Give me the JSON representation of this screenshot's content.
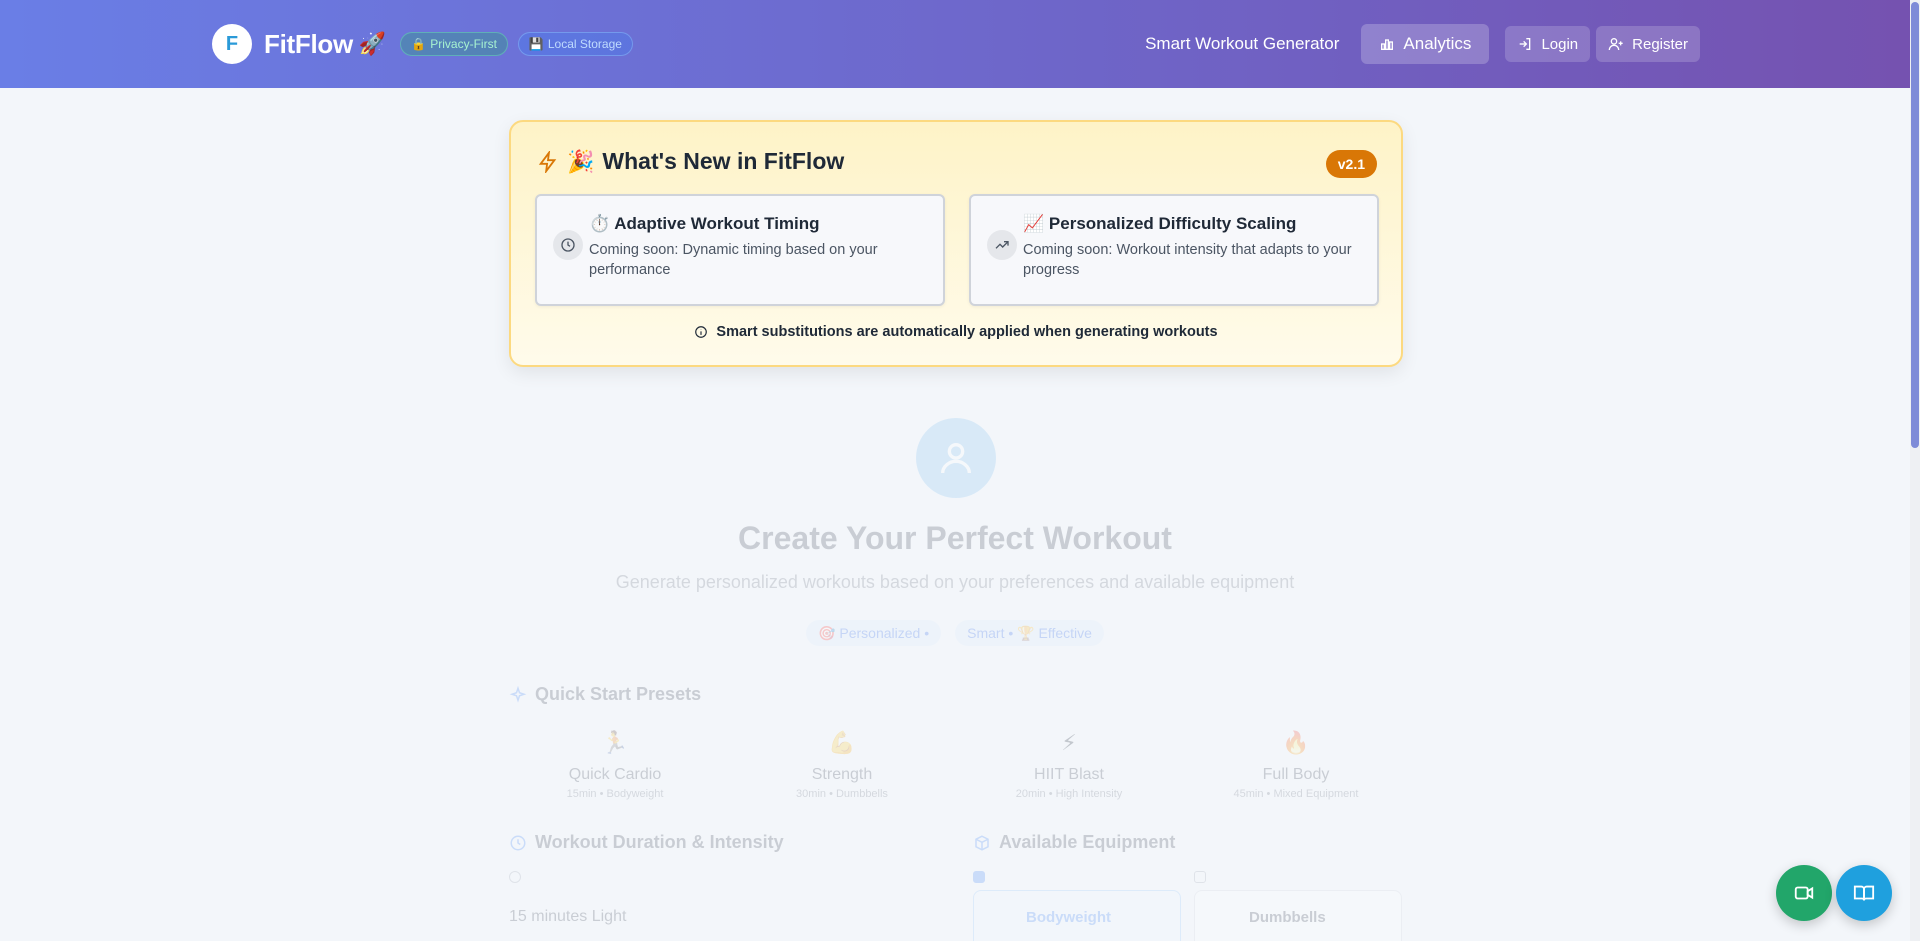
{
  "header": {
    "logo_letter": "F",
    "app_name": "FitFlow",
    "app_emoji": "🚀",
    "badges": [
      {
        "icon": "🔒",
        "label": "Privacy-First"
      },
      {
        "icon": "💾",
        "label": "Local Storage"
      }
    ],
    "nav_title": "Smart Workout Generator",
    "analytics_label": "Analytics",
    "login_label": "Login",
    "register_label": "Register"
  },
  "whats_new": {
    "title_emoji": "🎉",
    "title": "What's New in FitFlow",
    "version": "v2.1",
    "features": [
      {
        "icon": "clock-icon",
        "emoji": "⏱️",
        "title": "Adaptive Workout Timing",
        "description": "Coming soon: Dynamic timing based on your performance"
      },
      {
        "icon": "trending-up-icon",
        "emoji": "📈",
        "title": "Personalized Difficulty Scaling",
        "description": "Coming soon: Workout intensity that adapts to your progress"
      }
    ],
    "note": "Smart substitutions are automatically applied when generating workouts"
  },
  "main": {
    "title": "Create Your Perfect Workout",
    "subtitle": "Generate personalized workouts based on your preferences and available equipment",
    "tags": [
      "🎯 Personalized •",
      "Smart • 🏆 Effective"
    ],
    "quick_start_title": "Quick Start Presets",
    "presets": [
      {
        "emoji": "🏃",
        "name": "Quick Cardio",
        "meta": "15min • Bodyweight"
      },
      {
        "emoji": "💪",
        "name": "Strength",
        "meta": "30min • Dumbbells"
      },
      {
        "emoji": "⚡",
        "name": "HIIT Blast",
        "meta": "20min • High Intensity"
      },
      {
        "emoji": "🔥",
        "name": "Full Body",
        "meta": "45min • Mixed Equipment"
      }
    ],
    "duration_title": "Workout Duration & Intensity",
    "duration_option": "15 minutes Light",
    "equipment_title": "Available Equipment",
    "equipment": [
      "Bodyweight",
      "Dumbbells"
    ]
  },
  "colors": {
    "header_start": "#6a7ee6",
    "header_end": "#7552b0",
    "version_badge": "#d97706",
    "video_fab": "#22a66a",
    "guide_fab": "#1fa0de"
  }
}
